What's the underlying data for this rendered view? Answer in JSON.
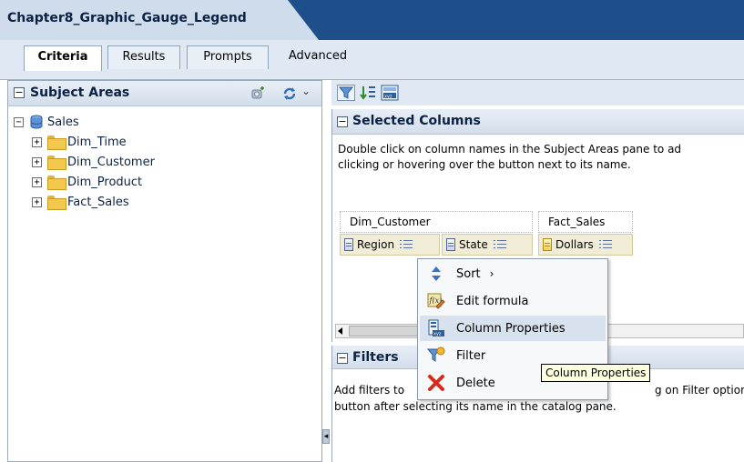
{
  "app": {
    "title": "Chapter8_Graphic_Gauge_Legend"
  },
  "tabs": [
    {
      "label": "Criteria",
      "active": true
    },
    {
      "label": "Results",
      "active": false
    },
    {
      "label": "Prompts",
      "active": false
    },
    {
      "label": "Advanced",
      "active": false
    }
  ],
  "subject_areas": {
    "title": "Subject Areas",
    "root": "Sales",
    "folders": [
      "Dim_Time",
      "Dim_Customer",
      "Dim_Product",
      "Fact_Sales"
    ]
  },
  "selected_columns": {
    "title": "Selected Columns",
    "instructions_line1": "Double click on column names in the Subject Areas pane to ad",
    "instructions_line2": "clicking or hovering over the button next to its name.",
    "groups": [
      "Dim_Customer",
      "Fact_Sales"
    ],
    "columns": [
      "Region",
      "State",
      "Dollars"
    ]
  },
  "filters": {
    "title": "Filters",
    "text_line1_start": "Add filters to",
    "text_line1_end": "g on Filter option for",
    "text_line2": "button after selecting its name in the catalog pane."
  },
  "context_menu": {
    "items": [
      "Sort",
      "Edit formula",
      "Column Properties",
      "Filter",
      "Delete"
    ],
    "submenu_arrow": "›"
  },
  "tooltip": "Column Properties",
  "colors": {
    "titlebar": "#1f4f8a",
    "menu_highlight": "#d8e2ee",
    "tooltip_bg": "#ffffe1",
    "delete_red": "#d62a1e"
  }
}
